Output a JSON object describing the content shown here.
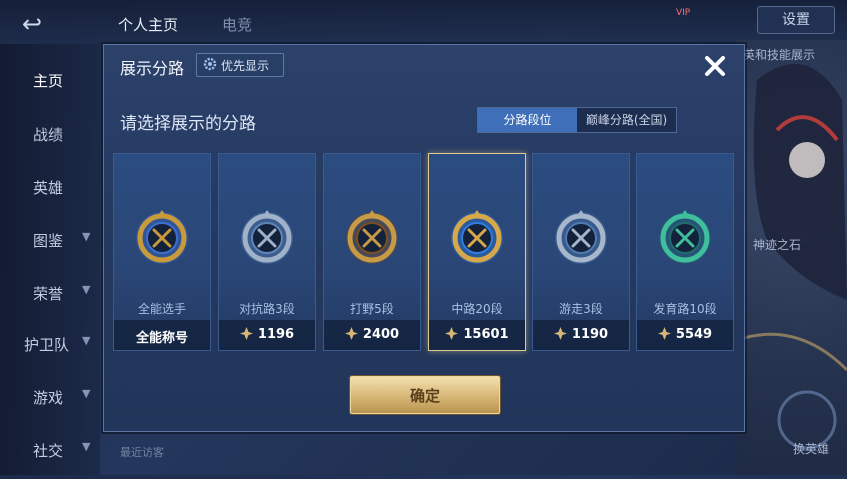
{
  "background": {
    "tabs": [
      "个人主页",
      "电竞"
    ],
    "settings_label": "设置",
    "sidebar": [
      {
        "label": "主页",
        "arrow": false
      },
      {
        "label": "战绩",
        "arrow": false
      },
      {
        "label": "英雄",
        "arrow": false
      },
      {
        "label": "图鉴",
        "arrow": true
      },
      {
        "label": "荣誉",
        "arrow": true
      },
      {
        "label": "护卫队",
        "arrow": true
      },
      {
        "label": "游戏",
        "arrow": true
      },
      {
        "label": "社交",
        "arrow": true
      }
    ],
    "recent_visitors": "最近访客",
    "deco_texts": [
      "英和技能展示",
      "神迹之石",
      "换英雄"
    ],
    "vip_badge": "VIP"
  },
  "dialog": {
    "title": "展示分路",
    "priority_button": "优先显示",
    "prompt": "请选择展示的分路",
    "segments": [
      "分路段位",
      "巅峰分路(全国)"
    ],
    "confirm_label": "确定",
    "cards": [
      {
        "position": "全能选手",
        "value": "全能称号",
        "icon": false,
        "emblem": "allround-emblem",
        "colors": [
          "#c89a3a",
          "#3d6fd0"
        ]
      },
      {
        "position": "对抗路3段",
        "value": "1196",
        "icon": true,
        "emblem": "clash-lane-emblem",
        "colors": [
          "#9fb2c8",
          "#5f86b8"
        ]
      },
      {
        "position": "打野5段",
        "value": "2400",
        "icon": true,
        "emblem": "jungle-emblem",
        "colors": [
          "#c79a45",
          "#7a4e1e"
        ]
      },
      {
        "position": "中路20段",
        "value": "15601",
        "icon": true,
        "emblem": "mid-lane-emblem",
        "colors": [
          "#d7a84a",
          "#2f7de0"
        ]
      },
      {
        "position": "游走3段",
        "value": "1190",
        "icon": true,
        "emblem": "roam-emblem",
        "colors": [
          "#a6b7cc",
          "#4f7bb0"
        ]
      },
      {
        "position": "发育路10段",
        "value": "5549",
        "icon": true,
        "emblem": "farm-lane-emblem",
        "colors": [
          "#3fbf9b",
          "#1f6b6e"
        ]
      }
    ]
  },
  "colors": {
    "accent": "#3f6fb8",
    "selected_border": "#e0c891",
    "confirm_gold": "#d7b676"
  }
}
